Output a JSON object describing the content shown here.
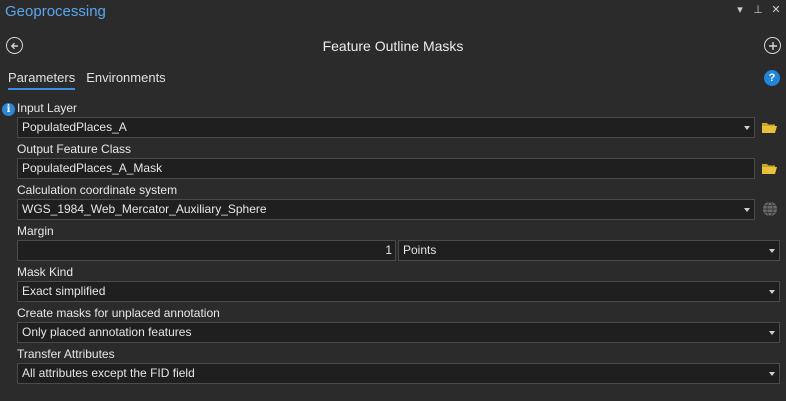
{
  "app": {
    "title": "Geoprocessing"
  },
  "window_controls": {
    "menu": "▾",
    "pin": "⊥",
    "close": "✕"
  },
  "tool": {
    "title": "Feature Outline Masks"
  },
  "tabs": [
    {
      "label": "Parameters",
      "active": true
    },
    {
      "label": "Environments",
      "active": false
    }
  ],
  "help": {
    "symbol": "?"
  },
  "info": {
    "symbol": "i"
  },
  "params": {
    "input_layer": {
      "label": "Input Layer",
      "value": "PopulatedPlaces_A"
    },
    "output_fc": {
      "label": "Output Feature Class",
      "value": "PopulatedPlaces_A_Mask"
    },
    "coord_sys": {
      "label": "Calculation coordinate system",
      "value": "WGS_1984_Web_Mercator_Auxiliary_Sphere"
    },
    "margin": {
      "label": "Margin",
      "value": "1",
      "unit": "Points"
    },
    "mask_kind": {
      "label": "Mask Kind",
      "value": "Exact simplified"
    },
    "unplaced": {
      "label": "Create masks for unplaced annotation",
      "value": "Only placed annotation features"
    },
    "transfer": {
      "label": "Transfer Attributes",
      "value": "All attributes except the FID field"
    }
  },
  "colors": {
    "accent": "#3d8fe0",
    "title_blue": "#5aa7f0",
    "folder": "#e8c13a",
    "background": "#2b2b2b",
    "field_bg": "#1f1f1f"
  }
}
